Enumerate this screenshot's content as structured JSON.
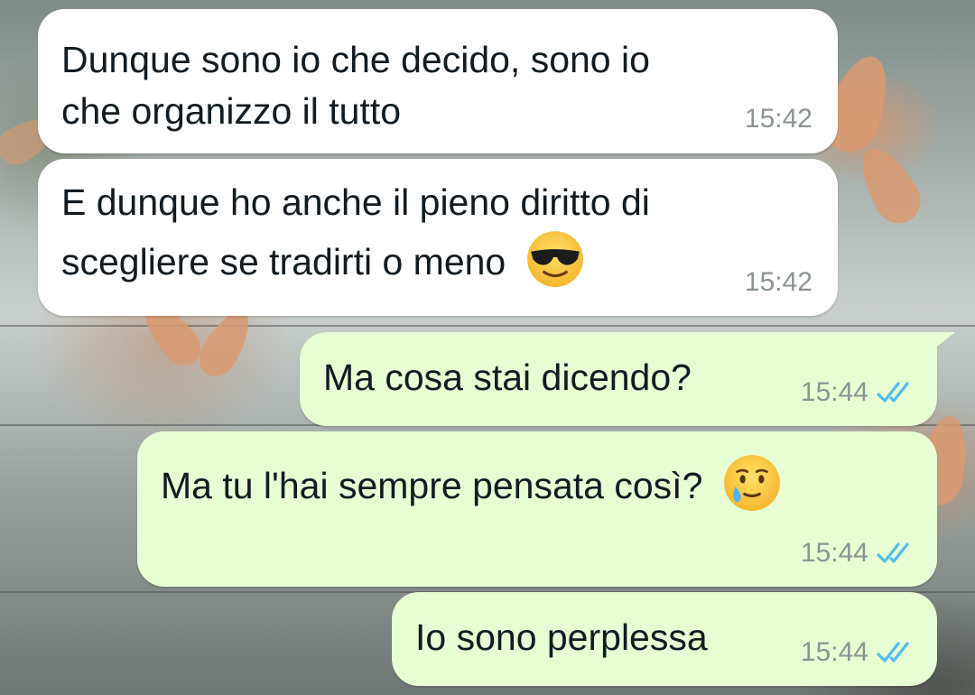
{
  "chat": {
    "messages": [
      {
        "direction": "incoming",
        "lines": [
          "Dunque sono io che decido, sono io",
          "che organizzo il tutto"
        ],
        "time": "15:42",
        "emoji": null
      },
      {
        "direction": "incoming",
        "lines": [
          "E dunque ho anche il pieno diritto di",
          "scegliere se tradirti o meno"
        ],
        "time": "15:42",
        "emoji": "smiling-face-with-sunglasses"
      },
      {
        "direction": "outgoing",
        "lines": [
          "Ma cosa stai dicendo?"
        ],
        "time": "15:44",
        "status": "read",
        "emoji": null
      },
      {
        "direction": "outgoing",
        "lines": [
          "Ma tu l'hai sempre pensata così?"
        ],
        "time": "15:44",
        "status": "read",
        "emoji": "smiling-face-with-tear"
      },
      {
        "direction": "outgoing",
        "lines": [
          "Io sono perplessa"
        ],
        "time": "15:44",
        "status": "read",
        "emoji": null
      }
    ]
  },
  "colors": {
    "incoming_bubble": "#ffffff",
    "outgoing_bubble": "#e7fed4",
    "text": "#111b21",
    "timestamp": "#8a9493",
    "read_ticks": "#53bdeb"
  }
}
